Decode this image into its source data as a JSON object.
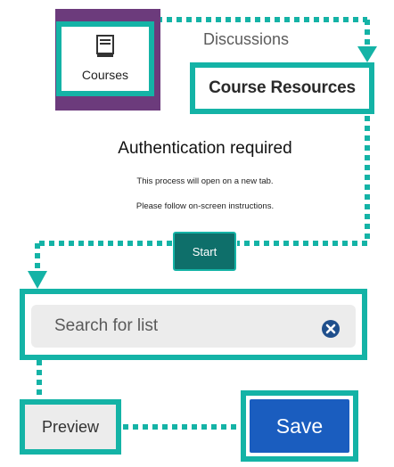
{
  "nav": {
    "courses_label": "Courses",
    "discussions_label": "Discussions",
    "course_resources_label": "Course Resources"
  },
  "auth": {
    "title": "Authentication required",
    "line1": "This process will open on a new tab.",
    "line2": "Please follow on-screen instructions.",
    "start_label": "Start"
  },
  "search": {
    "placeholder": "Search for list",
    "clear_icon": "clear-circle-x-icon"
  },
  "actions": {
    "preview_label": "Preview",
    "save_label": "Save"
  },
  "colors": {
    "highlight": "#14b3a6",
    "nav_purple": "#6c3b7c",
    "start_button": "#0e6f6a",
    "save_button": "#1a5dbf",
    "field_bg": "#ececec"
  }
}
